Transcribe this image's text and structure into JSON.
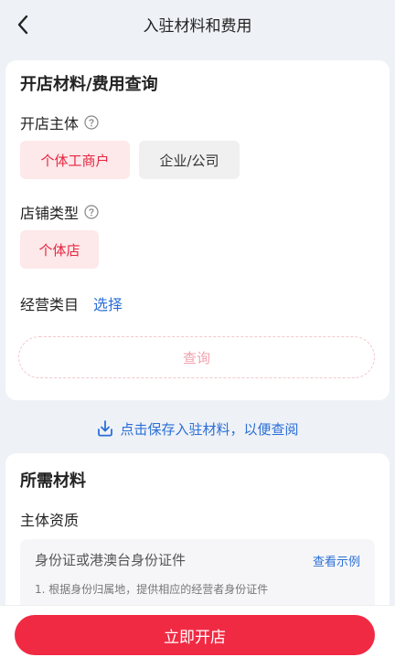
{
  "header": {
    "title": "入驻材料和费用"
  },
  "query_section": {
    "title": "开店材料/费用查询",
    "entity_label": "开店主体",
    "entity_options": [
      "个体工商户",
      "企业/公司"
    ],
    "store_type_label": "店铺类型",
    "store_type_options": [
      "个体店"
    ],
    "category_label": "经营类目",
    "category_action": "选择",
    "query_button": "查询"
  },
  "save_tip": "点击保存入驻材料，以便查阅",
  "materials": {
    "title": "所需材料",
    "subject_label": "主体资质",
    "doc_title": "身份证或港澳台身份证件",
    "doc_link": "查看示例",
    "doc_desc": "1. 根据身份归属地，提供相应的经营者身份证件"
  },
  "bottom": {
    "open_store_button": "立即开店"
  },
  "colors": {
    "accent": "#f12a44",
    "link": "#2a6fd6",
    "selected_bg": "#fde8ea"
  }
}
